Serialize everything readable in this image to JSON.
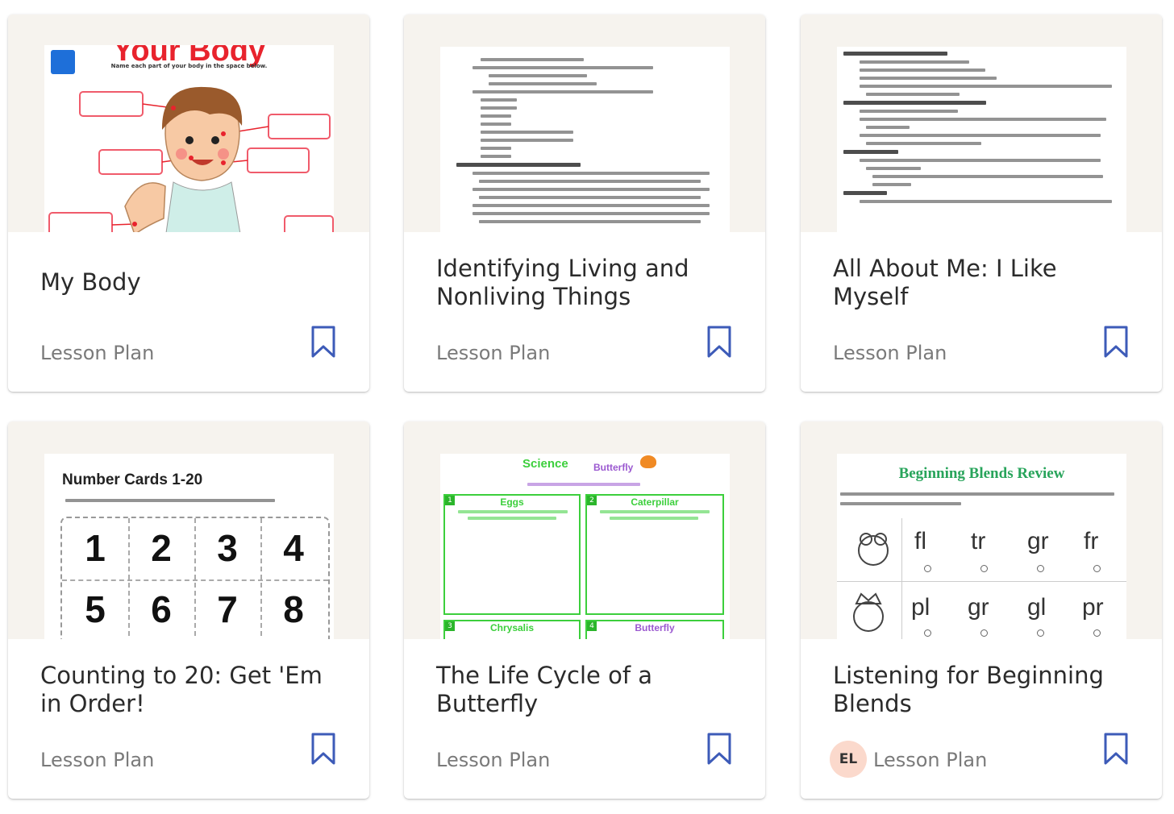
{
  "cards": [
    {
      "title": "My Body",
      "type": "Lesson Plan",
      "thumb_heading": "Your Body",
      "thumb_sub": "Name each part of your body in the space below."
    },
    {
      "title": "Identifying Living and Nonliving Things",
      "type": "Lesson Plan"
    },
    {
      "title": "All About Me: I Like Myself",
      "type": "Lesson Plan"
    },
    {
      "title": "Counting to 20: Get 'Em in Order!",
      "type": "Lesson Plan",
      "thumb_heading": "Number Cards 1-20",
      "numbers": [
        "1",
        "2",
        "3",
        "4",
        "5",
        "6",
        "7",
        "8"
      ]
    },
    {
      "title": "The Life Cycle of a Butterfly",
      "type": "Lesson Plan",
      "thumb_heading": "Science",
      "thumb_sub": "Butterfly",
      "stages": [
        "Eggs",
        "Caterpillar",
        "Chrysalis",
        "Butterfly"
      ]
    },
    {
      "title": "Listening for Beginning Blends",
      "type": "Lesson Plan",
      "badge": "EL",
      "thumb_heading": "Beginning Blends Review",
      "row1": [
        "fl",
        "tr",
        "gr",
        "fr"
      ],
      "row2": [
        "pl",
        "gr",
        "gl",
        "pr"
      ]
    }
  ],
  "colors": {
    "bookmark": "#3d5bb8",
    "badge_bg": "#fbd9cc",
    "accent_red": "#e8232d",
    "accent_green": "#3ccf3c"
  },
  "icons": {
    "bookmark": "bookmark-icon"
  }
}
